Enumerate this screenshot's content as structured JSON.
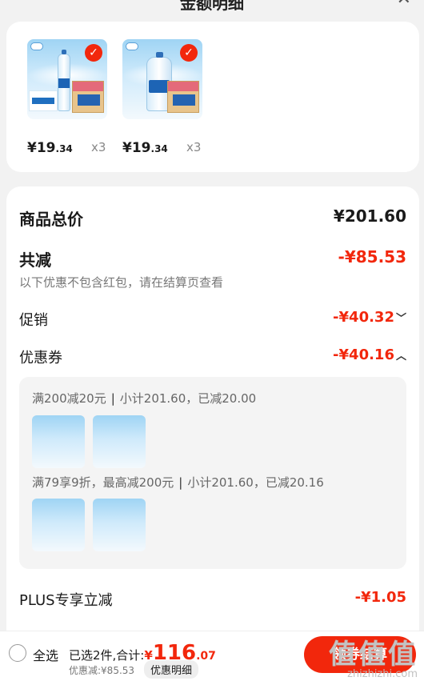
{
  "header": {
    "title": "金额明细",
    "close_icon": "close-icon"
  },
  "products": [
    {
      "price_int": "19",
      "price_dec": ".34",
      "qty": "x3",
      "selected": true,
      "image_type": "bottle"
    },
    {
      "price_int": "19",
      "price_dec": ".34",
      "qty": "x3",
      "selected": true,
      "image_type": "jug"
    }
  ],
  "currency": "¥",
  "summary": {
    "total_label": "商品总价",
    "total_value": "¥201.60",
    "reduce_label": "共减",
    "reduce_value": "-¥85.53",
    "reduce_note": "以下优惠不包含红包，请在结算页查看",
    "promo_label": "促销",
    "promo_value": "-¥40.32",
    "coupon_label": "优惠券",
    "coupon_value": "-¥40.16",
    "plus_label": "PLUS专享立减",
    "plus_value": "-¥1.05"
  },
  "coupon_rules": [
    {
      "rule": "满200减20元",
      "subtotal": "小计201.60，已减20.00"
    },
    {
      "rule": "满79享9折，最高减200元",
      "subtotal": "小计201.60，已减20.16"
    }
  ],
  "bottom": {
    "select_all": "全选",
    "selected_text": "已选2件,合计:",
    "total_int": "116",
    "total_dec": ".07",
    "discount_text": "优惠减:¥85.53",
    "detail_btn": "优惠明细",
    "checkout_btn": "领券结算"
  },
  "watermark": {
    "cn": "值值值",
    "en": "zhizhizhi.com"
  },
  "colors": {
    "accent": "#f2270c",
    "card": "#ffffff",
    "background": "#f2f2f2"
  }
}
